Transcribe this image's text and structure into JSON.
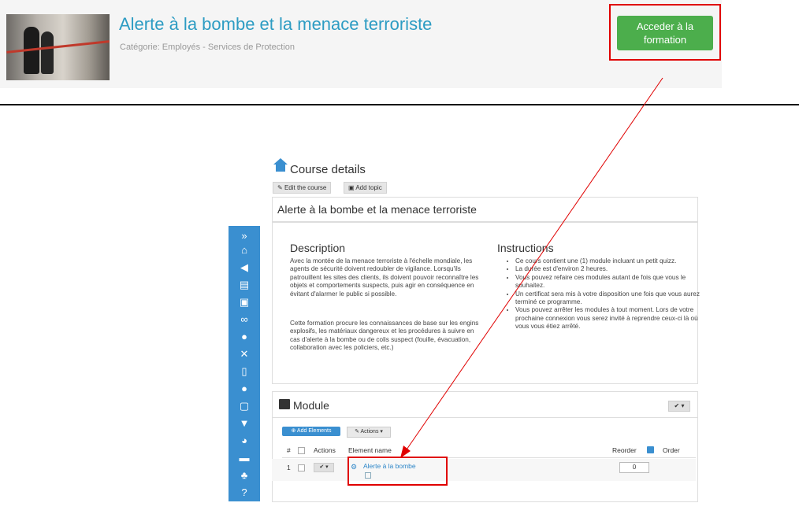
{
  "banner": {
    "title": "Alerte à la bombe et la menace terroriste",
    "category": "Catégorie: Employés - Services de Protection",
    "access_button": "Acceder à la formation"
  },
  "course_details": {
    "heading": "Course details",
    "edit_button": "Edit the course",
    "add_topic_button": "Add topic",
    "course_title": "Alerte à la bombe et la menace terroriste",
    "description_heading": "Description",
    "description_p1": "Avec la montée de la menace terroriste à l'échelle mondiale, les agents de sécurité doivent redoubler de vigilance. Lorsqu'ils patrouillent les sites des clients, ils doivent pouvoir reconnaître les objets et comportements suspects, puis agir en conséquence en évitant d'alarmer le public si possible.",
    "description_p2": "Cette formation procure les connaissances de base sur les engins explosifs, les matériaux dangereux et les procédures à suivre en cas d'alerte à la bombe ou de colis suspect (fouille, évacuation, collaboration avec les policiers, etc.)",
    "instructions_heading": "Instructions",
    "instructions": [
      "Ce cours contient une (1) module incluant un petit quizz.",
      "La durée est d'environ 2 heures.",
      "Vous pouvez refaire ces modules autant de fois que vous le souhaitez.",
      "Un certificat sera mis à votre disposition une fois que vous aurez terminé ce programme.",
      "Vous pouvez arrêter les modules à tout moment. Lors de votre prochaine connexion vous serez invité à reprendre ceux-ci là où vous vous étiez arrêté."
    ]
  },
  "module": {
    "heading": "Module",
    "add_elements": "Add Elements",
    "actions": "Actions",
    "columns": {
      "num": "#",
      "actions": "Actions",
      "element_name": "Element name",
      "reorder": "Reorder",
      "order": "Order"
    },
    "rows": [
      {
        "num": "1",
        "name": "Alerte à la bombe",
        "order": "0"
      }
    ]
  },
  "sidebar_icons": [
    "expand-icon",
    "home-icon",
    "megaphone-icon",
    "book-icon",
    "briefcase-icon",
    "link-icon",
    "lightbulb-icon",
    "tools-icon",
    "document-icon",
    "chat-icon",
    "presentation-icon",
    "graduation-icon",
    "pie-chart-icon",
    "inbox-icon",
    "users-icon",
    "help-icon"
  ],
  "colors": {
    "accent": "#2d9cc3",
    "button_green": "#4cae4c",
    "sidebar_blue": "#3a8fd0",
    "annotation_red": "#e00000"
  }
}
